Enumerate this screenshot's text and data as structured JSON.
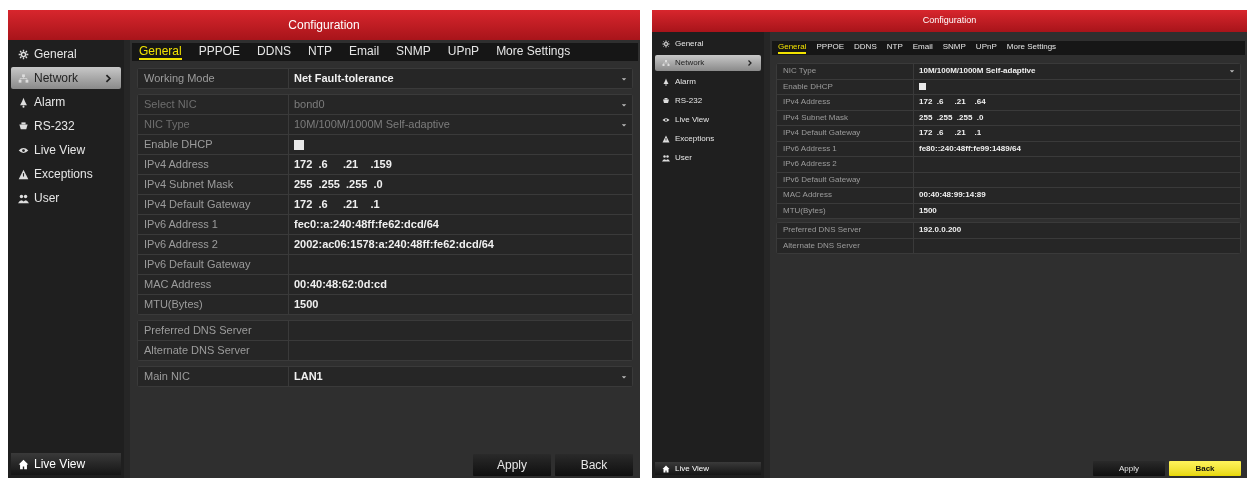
{
  "panels": [
    {
      "title": "Configuration",
      "sidebar": {
        "items": [
          {
            "label": "General",
            "selected": false
          },
          {
            "label": "Network",
            "selected": true
          },
          {
            "label": "Alarm",
            "selected": false
          },
          {
            "label": "RS-232",
            "selected": false
          },
          {
            "label": "Live View",
            "selected": false
          },
          {
            "label": "Exceptions",
            "selected": false
          },
          {
            "label": "User",
            "selected": false
          }
        ],
        "footer": "Live View"
      },
      "tabs": [
        {
          "label": "General",
          "selected": true
        },
        {
          "label": "PPPOE",
          "selected": false
        },
        {
          "label": "DDNS",
          "selected": false
        },
        {
          "label": "NTP",
          "selected": false
        },
        {
          "label": "Email",
          "selected": false
        },
        {
          "label": "SNMP",
          "selected": false
        },
        {
          "label": "UPnP",
          "selected": false
        },
        {
          "label": "More Settings",
          "selected": false
        }
      ],
      "groups": [
        [
          {
            "kind": "dropdown",
            "label": "Working Mode",
            "value": "Net Fault-tolerance",
            "disabled": false
          }
        ],
        [
          {
            "kind": "dropdown",
            "label": "Select NIC",
            "value": "bond0",
            "disabled": true
          },
          {
            "kind": "dropdown",
            "label": "NIC Type",
            "value": "10M/100M/1000M Self-adaptive",
            "disabled": true
          },
          {
            "kind": "checkbox",
            "label": "Enable DHCP",
            "checked": false,
            "disabled": false
          },
          {
            "kind": "text",
            "label": "IPv4 Address",
            "value": "172  .6     .21    .159",
            "disabled": false
          },
          {
            "kind": "text",
            "label": "IPv4 Subnet Mask",
            "value": "255  .255  .255  .0",
            "disabled": false
          },
          {
            "kind": "text",
            "label": "IPv4 Default Gateway",
            "value": "172  .6     .21    .1",
            "disabled": false
          },
          {
            "kind": "text",
            "label": "IPv6 Address 1",
            "value": "fec0::a:240:48ff:fe62:dcd/64",
            "disabled": false
          },
          {
            "kind": "text",
            "label": "IPv6 Address 2",
            "value": "2002:ac06:1578:a:240:48ff:fe62:dcd/64",
            "disabled": false
          },
          {
            "kind": "text",
            "label": "IPv6 Default Gateway",
            "disabled": false
          },
          {
            "kind": "text",
            "label": "MAC Address",
            "value": "00:40:48:62:0d:cd",
            "disabled": false
          },
          {
            "kind": "text",
            "label": "MTU(Bytes)",
            "value": "1500",
            "disabled": false
          }
        ],
        [
          {
            "kind": "text",
            "label": "Preferred DNS Server",
            "disabled": false
          },
          {
            "kind": "text",
            "label": "Alternate DNS Server",
            "disabled": false
          }
        ],
        [
          {
            "kind": "dropdown",
            "label": "Main NIC",
            "value": "LAN1",
            "disabled": false
          }
        ]
      ],
      "buttons": [
        {
          "label": "Apply",
          "focused": false
        },
        {
          "label": "Back",
          "focused": false
        }
      ]
    },
    {
      "title": "Configuration",
      "sidebar": {
        "items": [
          {
            "label": "General",
            "selected": false
          },
          {
            "label": "Network",
            "selected": true
          },
          {
            "label": "Alarm",
            "selected": false
          },
          {
            "label": "RS-232",
            "selected": false
          },
          {
            "label": "Live View",
            "selected": false
          },
          {
            "label": "Exceptions",
            "selected": false
          },
          {
            "label": "User",
            "selected": false
          }
        ],
        "footer": "Live View"
      },
      "tabs": [
        {
          "label": "General",
          "selected": true
        },
        {
          "label": "PPPOE",
          "selected": false
        },
        {
          "label": "DDNS",
          "selected": false
        },
        {
          "label": "NTP",
          "selected": false
        },
        {
          "label": "Email",
          "selected": false
        },
        {
          "label": "SNMP",
          "selected": false
        },
        {
          "label": "UPnP",
          "selected": false
        },
        {
          "label": "More Settings",
          "selected": false
        }
      ],
      "groups": [
        [
          {
            "kind": "dropdown",
            "label": "NIC Type",
            "value": "10M/100M/1000M Self-adaptive",
            "disabled": false
          },
          {
            "kind": "checkbox",
            "label": "Enable DHCP",
            "checked": false,
            "disabled": false
          },
          {
            "kind": "text",
            "label": "IPv4 Address",
            "value": "172  .6     .21    .64",
            "disabled": false
          },
          {
            "kind": "text",
            "label": "IPv4 Subnet Mask",
            "value": "255  .255  .255  .0",
            "disabled": false
          },
          {
            "kind": "text",
            "label": "IPv4 Default Gateway",
            "value": "172  .6     .21    .1",
            "disabled": false
          },
          {
            "kind": "text",
            "label": "IPv6 Address 1",
            "value": "fe80::240:48ff:fe99:1489/64",
            "disabled": false
          },
          {
            "kind": "text",
            "label": "IPv6 Address 2",
            "disabled": false
          },
          {
            "kind": "text",
            "label": "IPv6 Default Gateway",
            "disabled": false
          },
          {
            "kind": "text",
            "label": "MAC Address",
            "value": "00:40:48:99:14:89",
            "disabled": false
          },
          {
            "kind": "text",
            "label": "MTU(Bytes)",
            "value": "1500",
            "disabled": false
          }
        ],
        [
          {
            "kind": "text",
            "label": "Preferred DNS Server",
            "value": "192.0.0.200",
            "disabled": false
          },
          {
            "kind": "text",
            "label": "Alternate DNS Server",
            "disabled": false
          }
        ]
      ],
      "buttons": [
        {
          "label": "Apply",
          "focused": false
        },
        {
          "label": "Back",
          "focused": true
        }
      ]
    }
  ]
}
